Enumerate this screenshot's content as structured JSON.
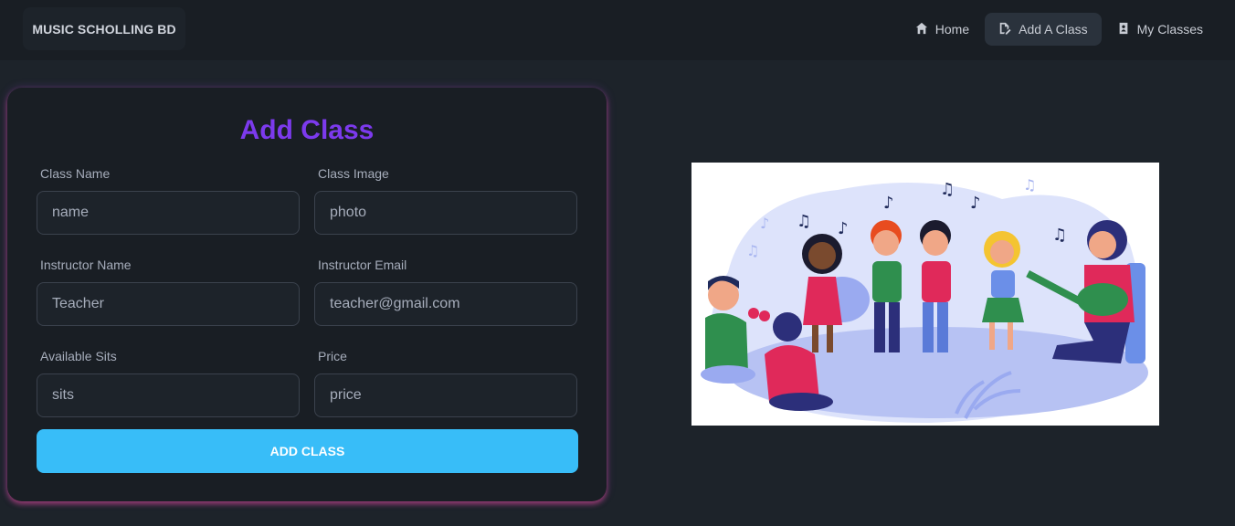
{
  "navbar": {
    "brand": "MUSIC SCHOLLING BD",
    "items": [
      {
        "label": "Home",
        "icon": "home-icon",
        "active": false
      },
      {
        "label": "Add A Class",
        "icon": "edit-file-icon",
        "active": true
      },
      {
        "label": "My Classes",
        "icon": "contact-card-icon",
        "active": false
      }
    ]
  },
  "form": {
    "title": "Add Class",
    "fields": {
      "class_name": {
        "label": "Class Name",
        "placeholder": "name"
      },
      "class_image": {
        "label": "Class Image",
        "placeholder": "photo"
      },
      "instructor_name": {
        "label": "Instructor Name",
        "value": "Teacher"
      },
      "instructor_email": {
        "label": "Instructor Email",
        "value": "teacher@gmail.com"
      },
      "available_sits": {
        "label": "Available Sits",
        "placeholder": "sits"
      },
      "price": {
        "label": "Price",
        "placeholder": "price"
      }
    },
    "submit_label": "ADD CLASS"
  },
  "colors": {
    "background": "#1d232a",
    "navbar": "#191e24",
    "title": "#7c3aed",
    "button": "#38bdf8",
    "card_glow": "#ec4899"
  }
}
